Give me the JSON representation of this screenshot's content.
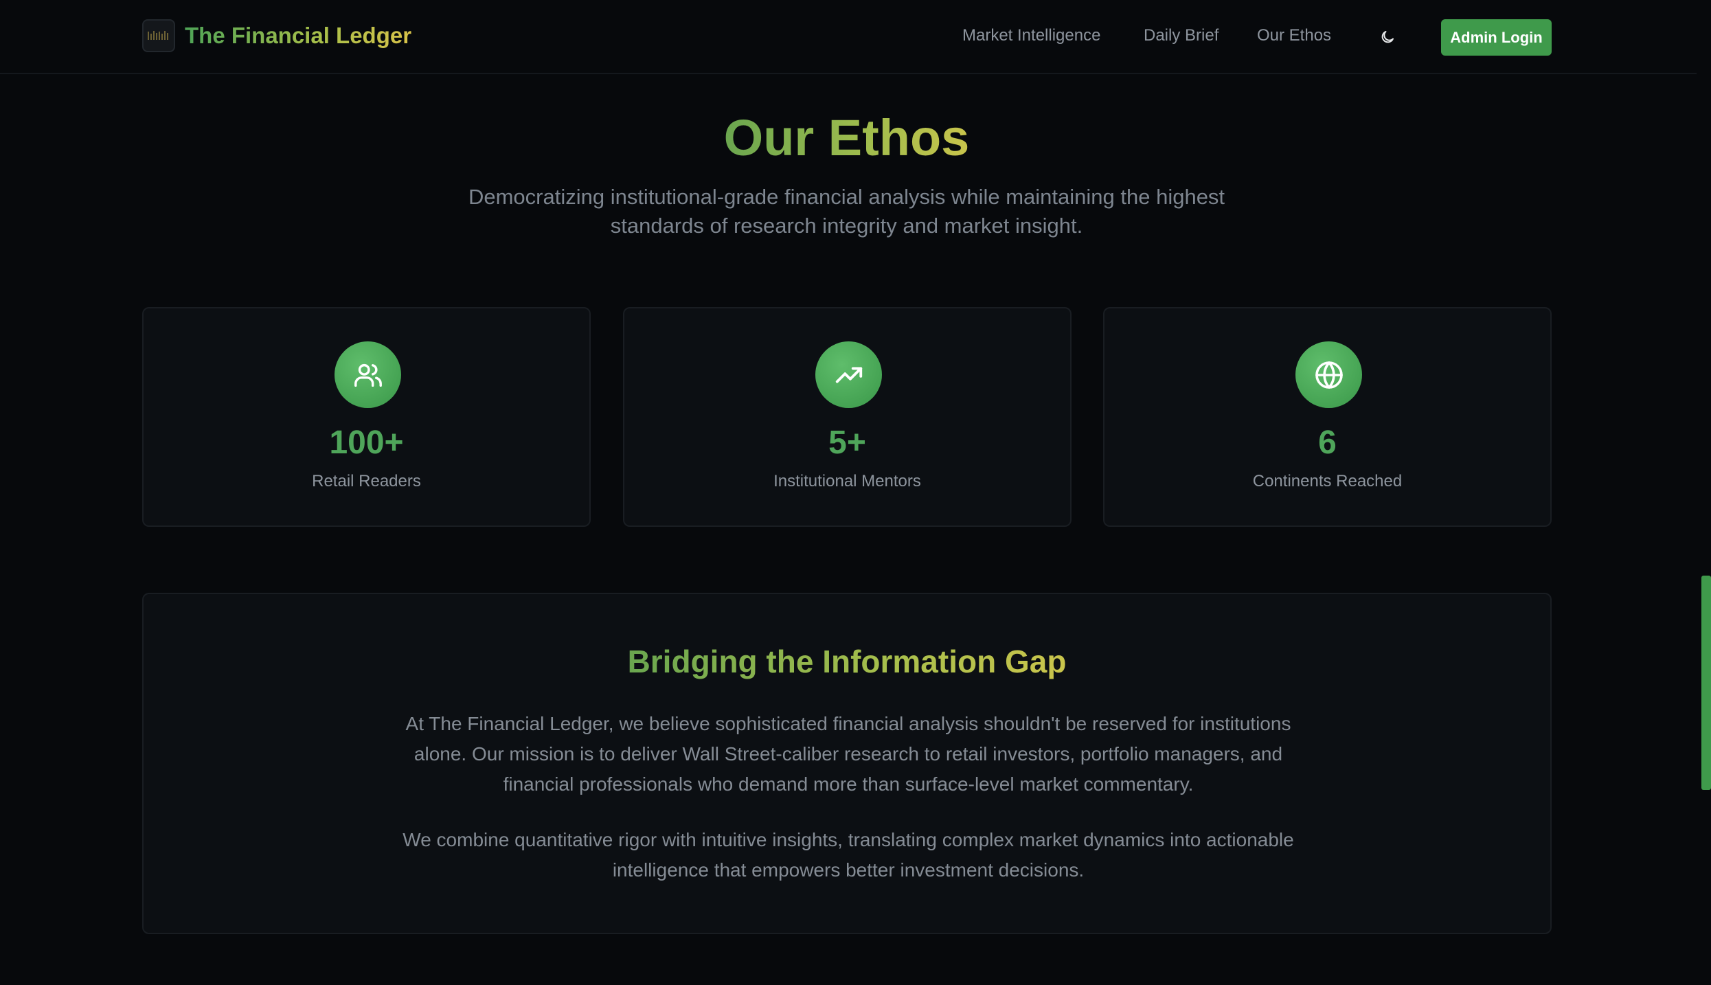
{
  "header": {
    "brand": "The Financial Ledger",
    "nav": [
      "Market Intelligence",
      "Daily Brief",
      "Our Ethos"
    ],
    "admin_login": "Admin Login"
  },
  "hero": {
    "title": "Our Ethos",
    "subtitle_line1": "Democratizing institutional-grade financial analysis while maintaining the highest",
    "subtitle_line2": "standards of research integrity and market insight."
  },
  "stats": [
    {
      "value": "100+",
      "label": "Retail Readers",
      "icon": "users-icon"
    },
    {
      "value": "5+",
      "label": "Institutional Mentors",
      "icon": "trending-up-icon"
    },
    {
      "value": "6",
      "label": "Continents Reached",
      "icon": "globe-icon"
    }
  ],
  "mission": {
    "title": "Bridging the Information Gap",
    "p1": "At The Financial Ledger, we believe sophisticated financial analysis shouldn't be reserved for institutions alone. Our mission is to deliver Wall Street-caliber research to retail investors, portfolio managers, and financial professionals who demand more than surface-level market commentary.",
    "p2": "We combine quantitative rigor with intuitive insights, translating complex market dynamics into actionable intelligence that empowers better investment decisions."
  },
  "colors": {
    "background": "#07090c",
    "card": "#0c0f13",
    "accent": "#3f9a4b",
    "stat_value": "#4fa55a"
  }
}
